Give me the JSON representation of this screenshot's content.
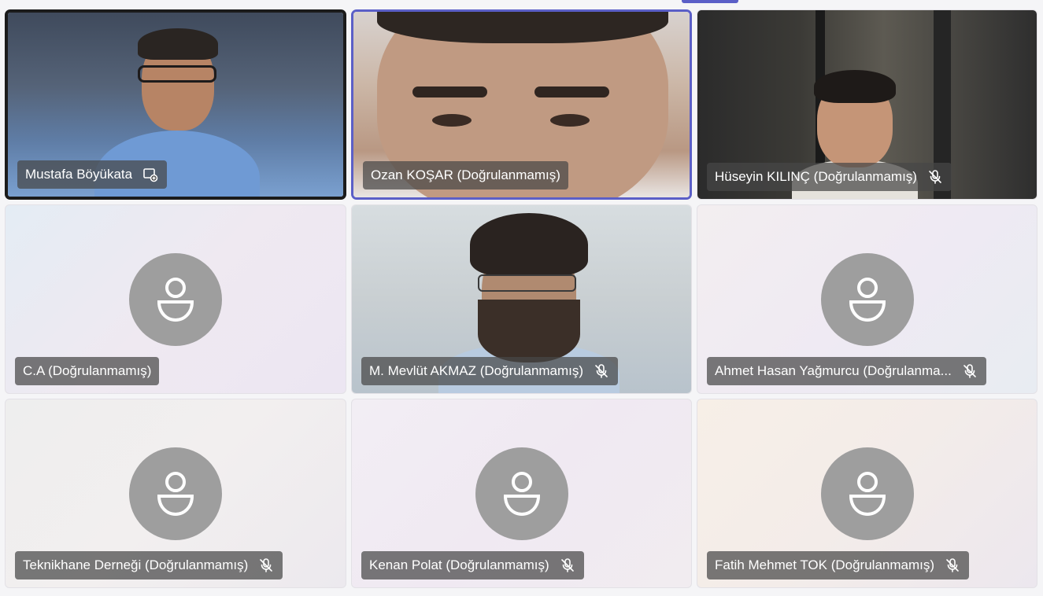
{
  "meeting": {
    "participants": [
      {
        "name": "Mustafa Böyükata",
        "status_icon": "screen-share-icon",
        "video": true
      },
      {
        "name": "Ozan KOŞAR (Doğrulanmamış)",
        "status_icon": null,
        "video": true
      },
      {
        "name": "Hüseyin KILINÇ (Doğrulanmamış)",
        "status_icon": "mic-muted-icon",
        "video": true
      },
      {
        "name": "C.A (Doğrulanmamış)",
        "status_icon": null,
        "video": false
      },
      {
        "name": "M. Mevlüt AKMAZ (Doğrulanmamış)",
        "status_icon": "mic-muted-icon",
        "video": true
      },
      {
        "name": "Ahmet Hasan Yağmurcu (Doğrulanma...",
        "status_icon": "mic-muted-icon",
        "video": false
      },
      {
        "name": "Teknikhane Derneği (Doğrulanmamış)",
        "status_icon": "mic-muted-icon",
        "video": false
      },
      {
        "name": "Kenan Polat (Doğrulanmamış)",
        "status_icon": "mic-muted-icon",
        "video": false
      },
      {
        "name": "Fatih Mehmet TOK (Doğrulanmamış)",
        "status_icon": "mic-muted-icon",
        "video": false
      }
    ]
  },
  "colors": {
    "accent": "#5b5fc7",
    "active_speaker_border": "#1b1b1b",
    "avatar_bg": "#9e9e9e",
    "name_pill_bg": "#464646"
  }
}
